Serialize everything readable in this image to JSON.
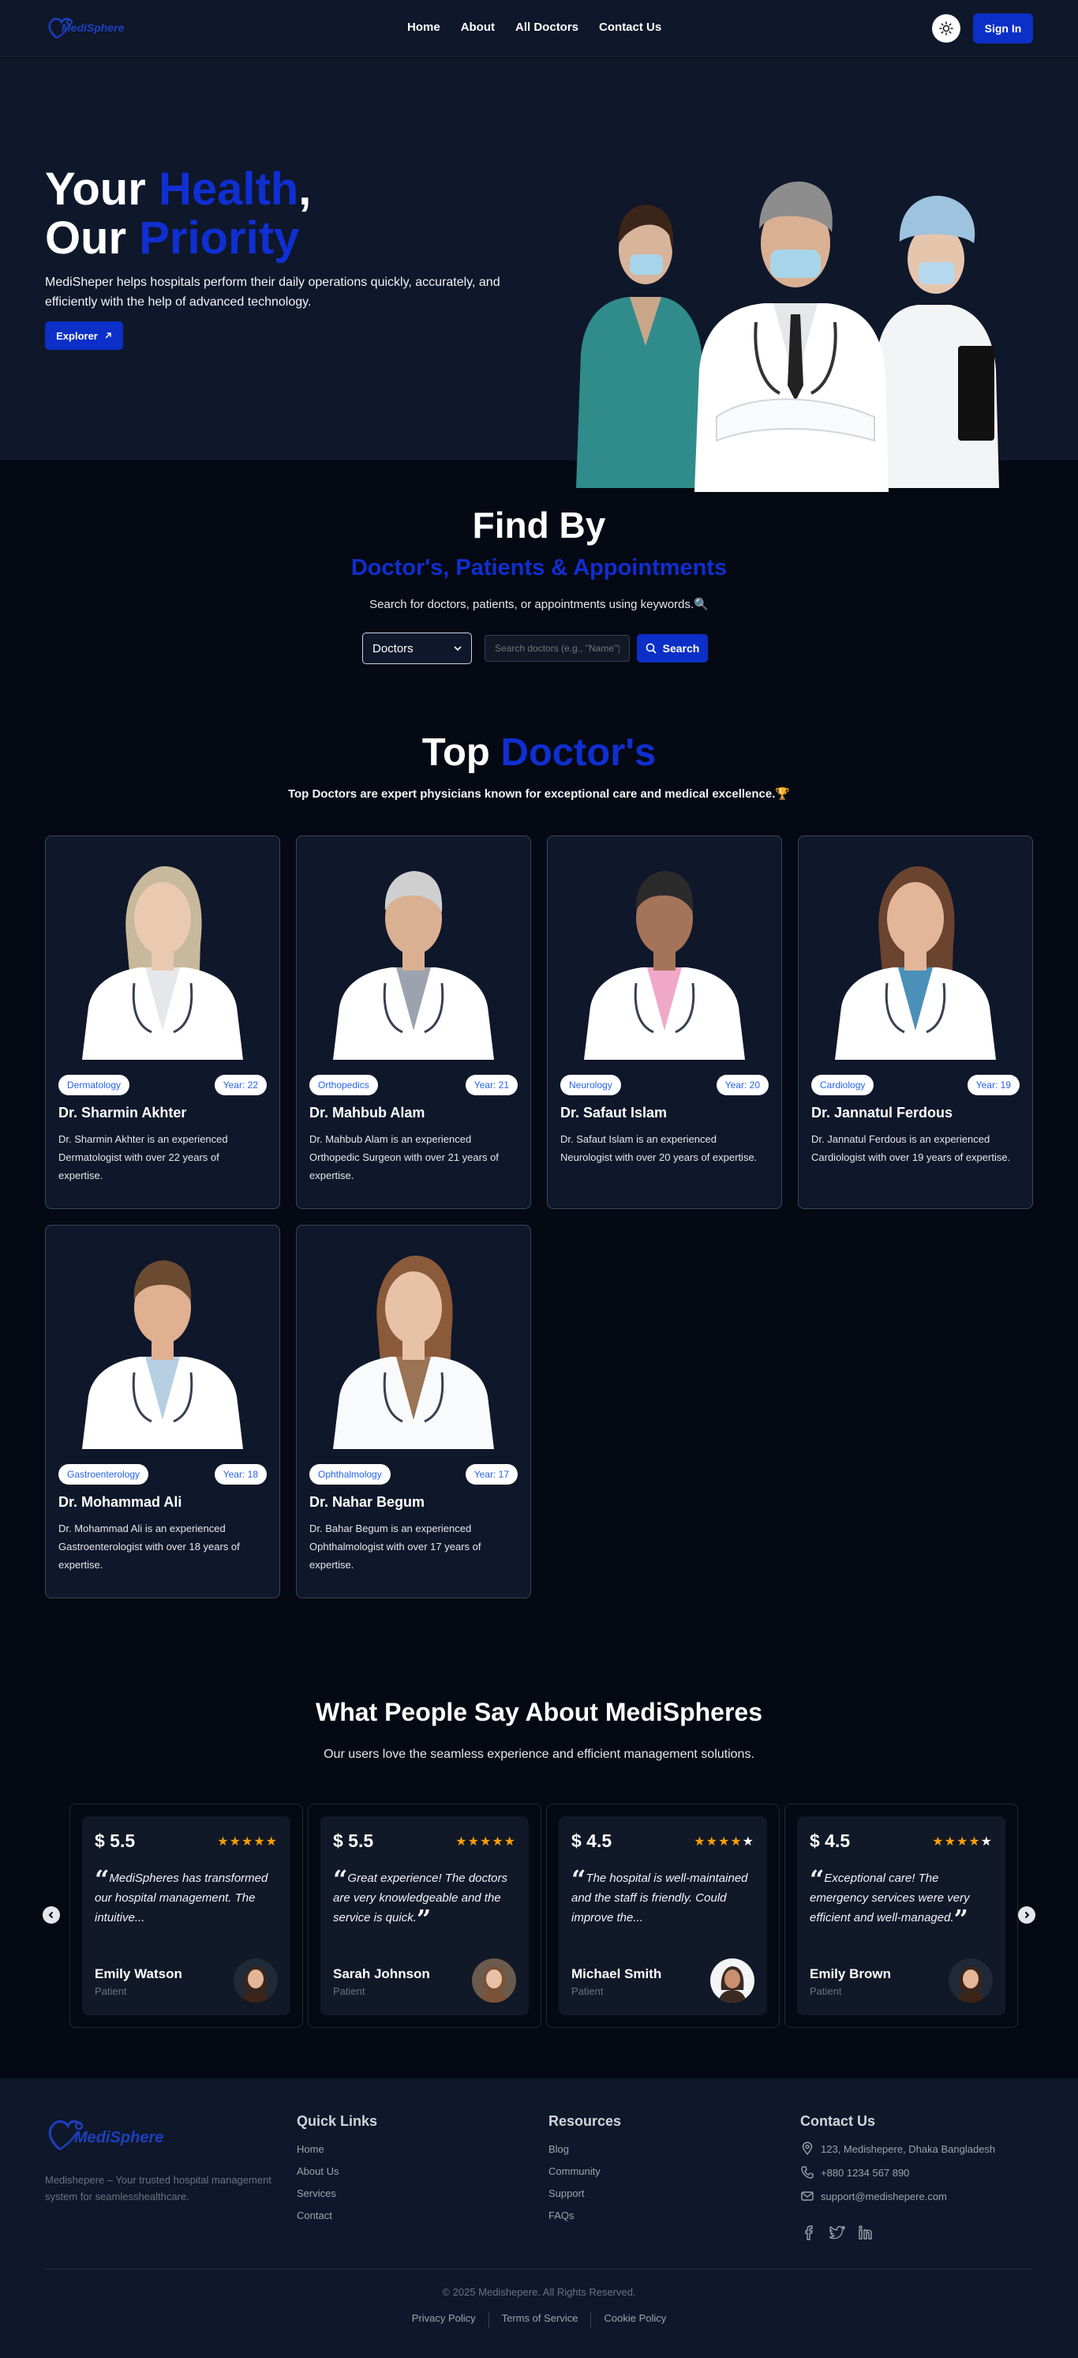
{
  "nav": {
    "logo_text": "MediSphere",
    "links": [
      "Home",
      "About",
      "All Doctors",
      "Contact Us"
    ],
    "signin_label": "Sign In"
  },
  "hero": {
    "title_line1_a": "Your ",
    "title_line1_b": "Health",
    "title_line1_c": ",",
    "title_line2_a": "Our ",
    "title_line2_b": "Priority",
    "description": "MediSheper helps hospitals perform their daily operations quickly, accurately, and efficiently with the help of advanced technology.",
    "cta_label": "Explorer"
  },
  "find": {
    "title": "Find By",
    "subtitle": "Doctor's, Patients & Appointments",
    "description": "Search for doctors, patients, or appointments using keywords.🔍",
    "select_value": "Doctors",
    "input_placeholder": "Search doctors (e.g., \"Name\")",
    "search_label": "Search"
  },
  "top_doctors": {
    "title_a": "Top ",
    "title_b": "Doctor's",
    "description": "Top Doctors are expert physicians known for exceptional care and medical excellence.🏆",
    "doctors": [
      {
        "specialty": "Dermatology",
        "year": "Year: 22",
        "name": "Dr. Sharmin Akhter",
        "desc": "Dr. Sharmin Akhter is an experienced Dermatologist with over 22 years of expertise."
      },
      {
        "specialty": "Orthopedics",
        "year": "Year: 21",
        "name": "Dr. Mahbub Alam",
        "desc": "Dr. Mahbub Alam is an experienced Orthopedic Surgeon with over 21 years of expertise."
      },
      {
        "specialty": "Neurology",
        "year": "Year: 20",
        "name": "Dr. Safaut Islam",
        "desc": "Dr. Safaut Islam is an experienced Neurologist with over 20 years of expertise."
      },
      {
        "specialty": "Cardiology",
        "year": "Year: 19",
        "name": "Dr. Jannatul Ferdous",
        "desc": "Dr. Jannatul Ferdous is an experienced Cardiologist with over 19 years of expertise."
      },
      {
        "specialty": "Gastroenterology",
        "year": "Year: 18",
        "name": "Dr. Mohammad Ali",
        "desc": "Dr. Mohammad Ali is an experienced Gastroenterologist with over 18 years of expertise."
      },
      {
        "specialty": "Ophthalmology",
        "year": "Year: 17",
        "name": "Dr. Nahar Begum",
        "desc": "Dr. Bahar Begum is an experienced Ophthalmologist with over 17 years of expertise."
      }
    ]
  },
  "testimonials": {
    "title": "What People Say About MediSpheres",
    "description": "Our users love the seamless experience and efficient management solutions.",
    "items": [
      {
        "price": "$ 5.5",
        "rating": 5,
        "quote": "MediSpheres has transformed our hospital management. The intuitive...",
        "name": "Emily Watson",
        "role": "Patient"
      },
      {
        "price": "$ 5.5",
        "rating": 5,
        "quote": "Great experience! The doctors are very knowledgeable and the service is quick.",
        "name": "Sarah Johnson",
        "role": "Patient"
      },
      {
        "price": "$ 4.5",
        "rating": 4,
        "quote": "The hospital is well-maintained and the staff is friendly. Could improve the...",
        "name": "Michael Smith",
        "role": "Patient"
      },
      {
        "price": "$ 4.5",
        "rating": 4,
        "quote": "Exceptional care! The emergency services were very efficient and well-managed.",
        "name": "Emily Brown",
        "role": "Patient"
      }
    ]
  },
  "footer": {
    "logo_text": "MediSphere",
    "tagline": "Medishepere – Your trusted hospital management system for seamlesshealthcare.",
    "quick_links_title": "Quick Links",
    "quick_links": [
      "Home",
      "About Us",
      "Services",
      "Contact"
    ],
    "resources_title": "Resources",
    "resources": [
      "Blog",
      "Community",
      "Support",
      "FAQs"
    ],
    "contact_title": "Contact Us",
    "address": "123, Medishepere, Dhaka Bangladesh",
    "phone": "+880 1234 567 890",
    "email": "support@medishepere.com",
    "copyright": "© 2025 Medishepere. All Rights Reserved.",
    "legal": [
      "Privacy Policy",
      "Terms of Service",
      "Cookie Policy"
    ]
  },
  "colors": {
    "accent_blue": "#0b2fc7",
    "page_bg": "#050913",
    "panel_bg": "#0f172a",
    "star": "#f59e0b"
  }
}
